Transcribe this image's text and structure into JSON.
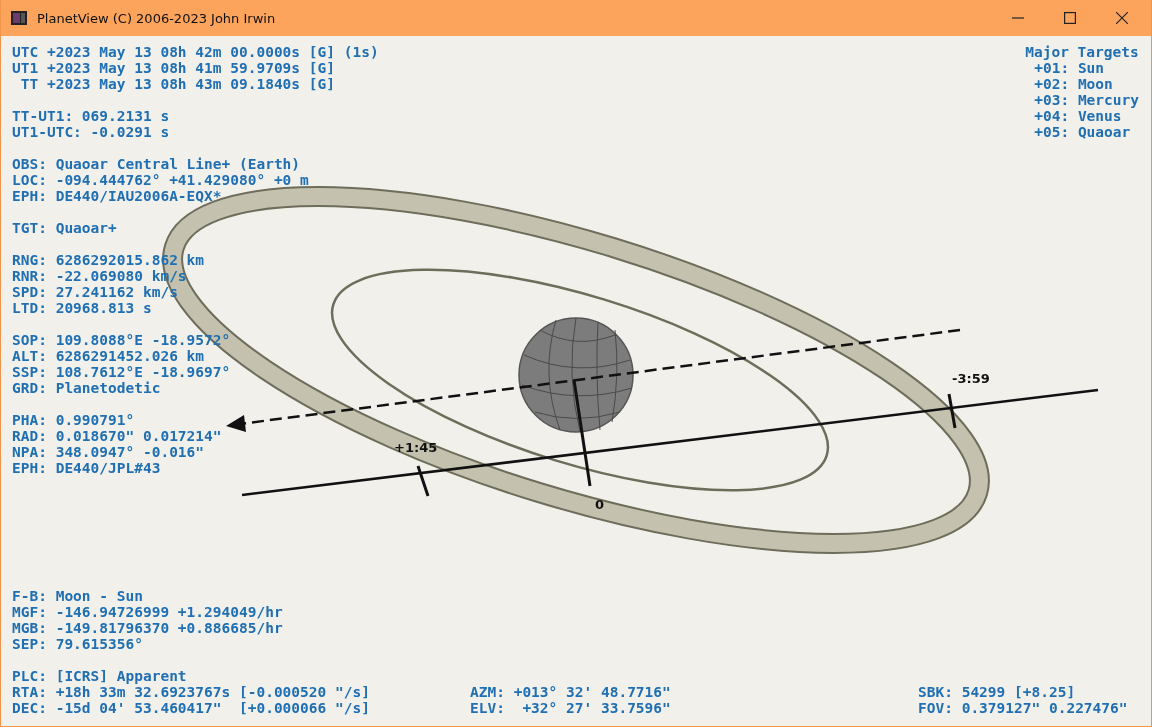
{
  "window": {
    "title": "PlanetView (C) 2006-2023 John Irwin"
  },
  "readouts_top": [
    [
      "UTC +2023 May 13 08h 42m 00.0000s [G] (1s)",
      "UT1 +2023 May 13 08h 41m 59.9709s [G]",
      " TT +2023 May 13 08h 43m 09.1840s [G]"
    ],
    [
      "TT-UT1: 069.2131 s",
      "UT1-UTC: -0.0291 s"
    ],
    [
      "OBS: Quaoar Central Line+ (Earth)",
      "LOC: -094.444762° +41.429080° +0 m",
      "EPH: DE440/IAU2006A-EQX*"
    ],
    [
      "TGT: Quaoar+"
    ],
    [
      "RNG: 6286292015.862 km",
      "RNR: -22.069080 km/s",
      "SPD: 27.241162 km/s",
      "LTD: 20968.813 s"
    ],
    [
      "SOP: 109.8088°E -18.9572°",
      "ALT: 6286291452.026 km",
      "SSP: 108.7612°E -18.9697°",
      "GRD: Planetodetic"
    ],
    [
      "PHA: 0.990791°",
      "RAD: 0.018670\" 0.017214\"",
      "NPA: 348.0947° -0.016\"",
      "EPH: DE440/JPL#43"
    ]
  ],
  "major_targets": {
    "title": "Major Targets",
    "items": [
      "+01: Sun",
      "+02: Moon",
      "+03: Mercury",
      "+04: Venus",
      "+05: Quaoar"
    ]
  },
  "diagram": {
    "tick_labels": [
      "+1:45",
      "0",
      "-3:59"
    ]
  },
  "readouts_bottom": [
    [
      "F-B: Moon - Sun",
      "MGF: -146.94726999 +1.294049/hr",
      "MGB: -149.81796370 +0.886685/hr",
      "SEP: 79.615356°"
    ],
    [
      "PLC: [ICRS] Apparent",
      "RTA: +18h 33m 32.6923767s [-0.000520 \"/s]",
      "DEC: -15d 04' 53.460417\"  [+0.000066 \"/s]"
    ]
  ],
  "horizontal": [
    "AZM: +013° 32' 48.7716\"",
    "ELV:  +32° 27' 33.7596\""
  ],
  "status": [
    "SBK: 54299 [+8.25]",
    "FOV: 0.379127\" 0.227476\""
  ]
}
